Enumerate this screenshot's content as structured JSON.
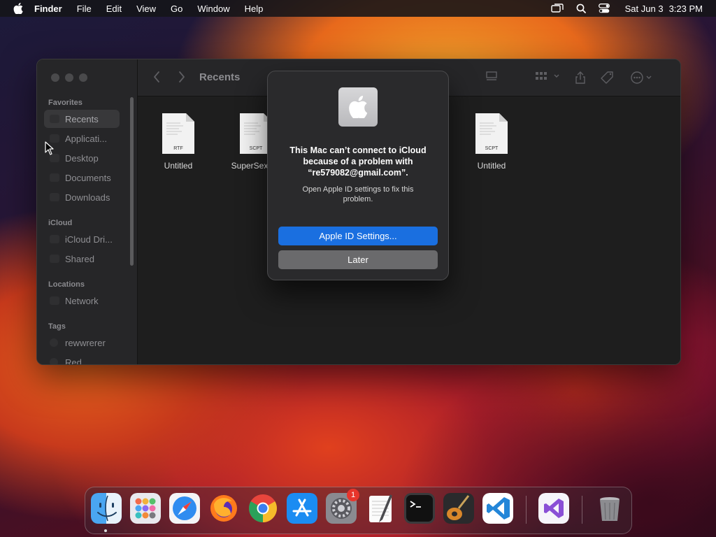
{
  "menubar": {
    "app_name": "Finder",
    "menus": [
      "File",
      "Edit",
      "View",
      "Go",
      "Window",
      "Help"
    ],
    "date": "Sat Jun 3",
    "time": "3:23 PM",
    "icons": [
      "apple-icon",
      "screen-mirroring-icon",
      "spotlight-search-icon",
      "control-center-icon"
    ]
  },
  "finder": {
    "title": "Recents",
    "sidebar": {
      "favorites_label": "Favorites",
      "favorites": [
        "Recents",
        "Applicati...",
        "Desktop",
        "Documents",
        "Downloads"
      ],
      "icloud_label": "iCloud",
      "icloud": [
        "iCloud Dri...",
        "Shared"
      ],
      "locations_label": "Locations",
      "locations": [
        "Network"
      ],
      "tags_label": "Tags",
      "tags": [
        "rewwrerer",
        "Red"
      ]
    },
    "files": [
      {
        "name": "Untitled",
        "type": "RTF"
      },
      {
        "name": "SuperSexyEr",
        "type": "SCPT"
      },
      {
        "name": "Untitled",
        "type": "SCPT"
      }
    ]
  },
  "dialog": {
    "message": "This Mac can’t connect to iCloud because of a problem with “re579082@gmail.com”.",
    "detail": "Open Apple ID settings to fix this problem.",
    "primary_button": "Apple ID Settings...",
    "secondary_button": "Later"
  },
  "dock": {
    "apps": [
      "Finder",
      "Launchpad",
      "Safari",
      "Firefox",
      "Chrome",
      "App Store",
      "System Settings",
      "TextEdit",
      "Terminal",
      "GarageBand",
      "Visual Studio Code",
      "Visual Studio",
      "Trash"
    ],
    "badge": "1"
  }
}
